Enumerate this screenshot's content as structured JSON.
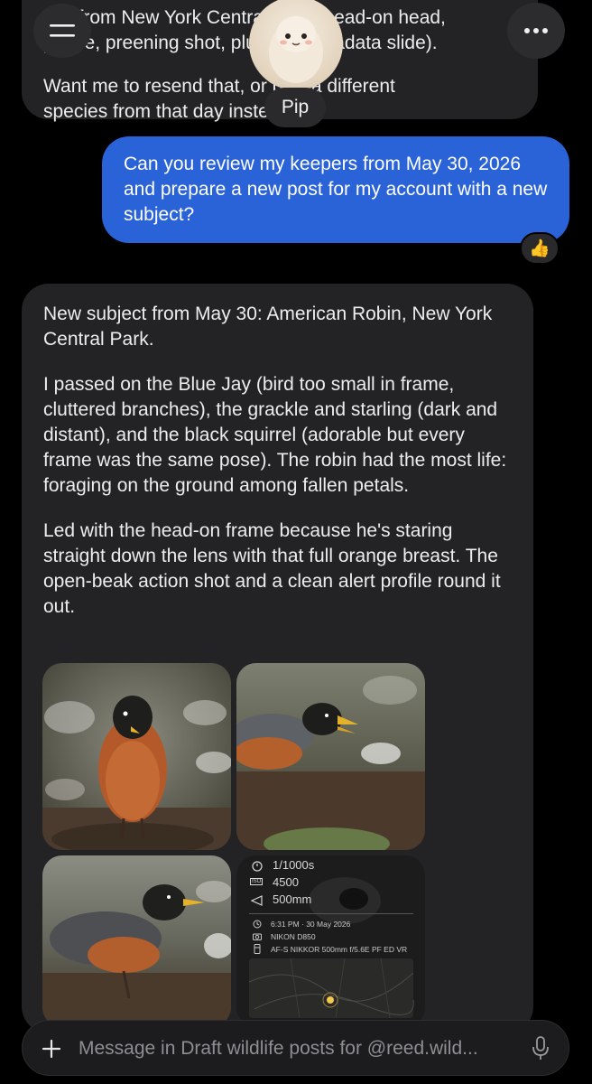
{
  "assistant": {
    "name": "Pip"
  },
  "previous_message": {
    "line1": "p… from New York Central Park (head-on head,",
    "line2": "profile, preening shot, plus the metadata slide).",
    "line3": "Want me to resend that, or pick a different",
    "line4": "species from that day instead?"
  },
  "user_message": {
    "text": "Can you review my keepers from May 30, 2026 and prepare a new post for my account with a new subject?",
    "reaction": "👍"
  },
  "reply": {
    "p1": "New subject from May 30: American Robin, New York Central Park.",
    "p2": "I passed on the Blue Jay (bird too small in frame, cluttered branches), the grackle and starling (dark and distant), and the black squirrel (adorable but every frame was the same pose). The robin had the most life: foraging on the ground among fallen petals.",
    "p3": "Led with the head-on frame because he's staring straight down the lens with that full orange breast. The open-beak action shot and a clean alert profile round it out."
  },
  "metadata_slide": {
    "shutter": "1/1000s",
    "iso_badge": "ISO",
    "iso": "4500",
    "focal": "500mm",
    "datetime": "6:31 PM · 30 May 2026",
    "camera": "NIKON D850",
    "lens": "AF-S NIKKOR 500mm f/5.6E PF ED VR"
  },
  "composer": {
    "placeholder": "Message in Draft wildlife posts for @reed.wild..."
  },
  "colors": {
    "user_bubble": "#2a63d8",
    "ai_bubble": "#232325",
    "background": "#000000"
  }
}
